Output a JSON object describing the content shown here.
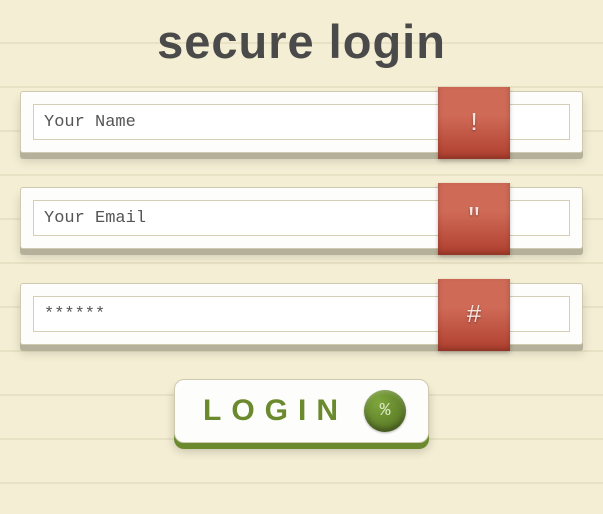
{
  "title": "secure login",
  "fields": {
    "name": {
      "placeholder": "Your Name",
      "badge": "!"
    },
    "email": {
      "placeholder": "Your Email",
      "badge": "\""
    },
    "password": {
      "value": "******",
      "badge": "#"
    }
  },
  "button": {
    "label": "LOGIN",
    "icon": "%"
  }
}
